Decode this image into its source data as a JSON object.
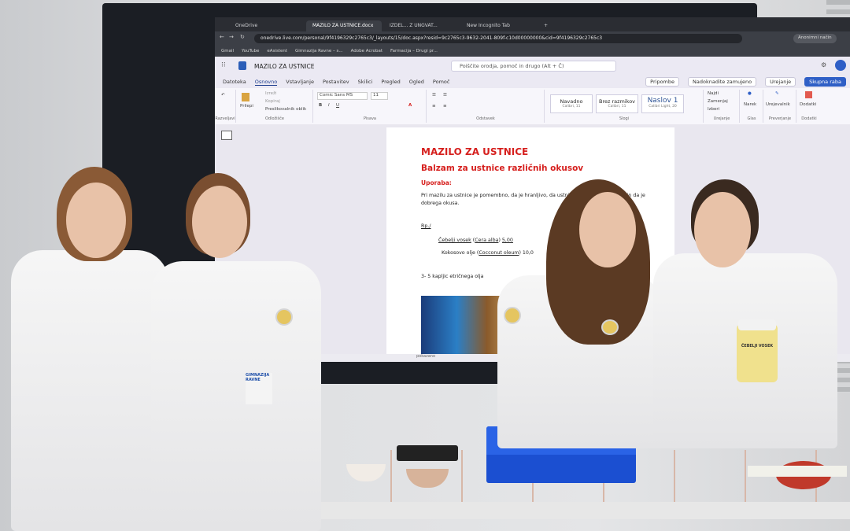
{
  "browser": {
    "tabs": [
      {
        "label": "OneDrive",
        "active": false
      },
      {
        "label": "MAZILO ZA USTNICE.docx",
        "active": true
      },
      {
        "label": "IZDEL... Z UNGVAT...",
        "active": false
      },
      {
        "label": "New Incognito Tab",
        "active": false
      }
    ],
    "new_tab": "+",
    "url": "onedrive.live.com/personal/9f4196329c2765c3/_layouts/15/doc.aspx?resid=9c2765c3-9632-2041-809f-c10d00000000&cid=9f4196329c2765c3",
    "profile_label": "Anonimni način",
    "bookmarks": [
      "Gmail",
      "YouTube",
      "eAsistent",
      "Gimnazija Ravne – s...",
      "Adobe Acrobat",
      "Farmacija – Drugi pr..."
    ]
  },
  "word": {
    "app_title": "MAZILO ZA USTNICE",
    "search_placeholder": "Poiščite orodja, pomoč in drugo (Alt + Č)",
    "menu": [
      "Datoteka",
      "Osnovno",
      "Vstavljanje",
      "Postavitev",
      "Skilici",
      "Pregled",
      "Ogled",
      "Pomoč"
    ],
    "menu_selected": "Osnovno",
    "right_buttons": [
      "Pripombe",
      "Nadoknadite zamujeno",
      "Urejanje",
      "Skupna raba"
    ],
    "ribbon": {
      "undo_label": "Razveljavi",
      "paste_label": "Prilepi",
      "clipboard_items": [
        "Izreži",
        "Kopiraj",
        "Preslikovalnik oblik"
      ],
      "clipboard_group": "Odložišče",
      "font_name": "Comic Sans MS",
      "font_size": "11",
      "font_group": "Pisava",
      "paragraph_group": "Odstavek",
      "styles": [
        {
          "name": "Navadno",
          "sub": "Calibri, 11"
        },
        {
          "name": "Brez razmikov",
          "sub": "Calibri, 11"
        },
        {
          "name": "Naslov 1",
          "sub": "Calibri Light, 20"
        }
      ],
      "styles_group": "Slogi",
      "editing_items": [
        "Najdi",
        "Zamenjaj",
        "Izberi"
      ],
      "editing_group": "Urejanje",
      "voice_label": "Narek",
      "voice_group": "Glas",
      "editor_label": "Urejevalnik",
      "editor_group": "Preverjanje",
      "addins_label": "Dodatki",
      "addins_group": "Dodatki"
    },
    "status_text": "pokazano"
  },
  "document": {
    "title": "MAZILO ZA USTNICE",
    "subtitle": "Balzam za ustnice različnih okusov",
    "usage_heading": "Uporaba:",
    "usage_text": "Pri mazilu za ustnice je pomembno, da je hranljivo, da ustnice ščiti pred izsušitvijo in da je dobrega okusa.",
    "rp": "Rp./",
    "ingredients": [
      {
        "name": "Čebelji vosek",
        "latin": "Cera alba",
        "amount": "5,00"
      },
      {
        "name": "Kokosovo olje",
        "latin": "Cocconut oleum",
        "amount": "10,0"
      }
    ],
    "drops": "3- 5 kapljic etričnega olja"
  },
  "scene": {
    "jar_label": "ČEBELJI VOSEK",
    "badge_text": "GIMNAZIJA RAVNE"
  },
  "colors": {
    "doc_red": "#d6201e",
    "accent_blue": "#2f5fc6",
    "crate_blue": "#1b4fd1"
  }
}
